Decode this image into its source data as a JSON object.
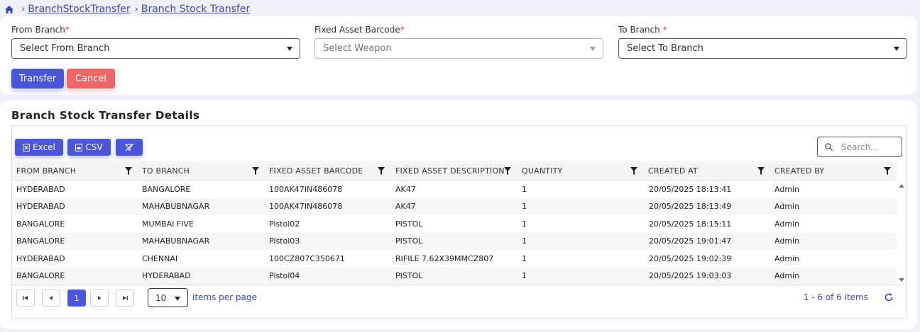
{
  "breadcrumb": {
    "items": [
      "BranchStockTransfer",
      "Branch Stock Transfer"
    ]
  },
  "form": {
    "from_branch": {
      "label": "From Branch",
      "required_mark": "*",
      "value": "Select From Branch"
    },
    "barcode": {
      "label": "Fixed Asset Barcode",
      "required_mark": "*",
      "value": "Select Weapon"
    },
    "to_branch": {
      "label": "To Branch ",
      "required_mark": "*",
      "value": "Select To Branch"
    },
    "transfer_label": "Transfer",
    "cancel_label": "Cancel"
  },
  "details": {
    "title": "Branch Stock Transfer Details",
    "excel_label": "Excel",
    "csv_label": "CSV",
    "search_placeholder": "Search..."
  },
  "table": {
    "columns": [
      "FROM BRANCH",
      "TO BRANCH",
      "FIXED ASSET BARCODE",
      "FIXED ASSET DESCRIPTION",
      "QUANTITY",
      "CREATED AT",
      "CREATED BY"
    ],
    "rows": [
      [
        "HYDERABAD",
        "BANGALORE",
        "100AK47IN486078",
        "AK47",
        "1",
        "20/05/2025 18:13:41",
        "Admin"
      ],
      [
        "HYDERABAD",
        "MAHABUBNAGAR",
        "100AK47IN486078",
        "AK47",
        "1",
        "20/05/2025 18:13:49",
        "Admin"
      ],
      [
        "BANGALORE",
        "MUMBAI FIVE",
        "Pistol02",
        "PISTOL",
        "1",
        "20/05/2025 18:15:11",
        "Admin"
      ],
      [
        "BANGALORE",
        "MAHABUBNAGAR",
        "Pistol03",
        "PISTOL",
        "1",
        "20/05/2025 19:01:47",
        "Admin"
      ],
      [
        "HYDERABAD",
        "CHENNAI",
        "100CZ807C350671",
        "RIFILE 7.62X39MMCZ807",
        "1",
        "20/05/2025 19:02:39",
        "Admin"
      ],
      [
        "BANGALORE",
        "HYDERABAD",
        "Pistol04",
        "PISTOL",
        "1",
        "20/05/2025 19:03:03",
        "Admin"
      ]
    ]
  },
  "pager": {
    "current_page": "1",
    "page_size": "10",
    "items_per_page_label": "items per page",
    "summary": "1 - 6 of 6 items"
  },
  "colors": {
    "primary": "#4b55d9",
    "danger": "#f06666",
    "link": "#3f4aa8"
  }
}
